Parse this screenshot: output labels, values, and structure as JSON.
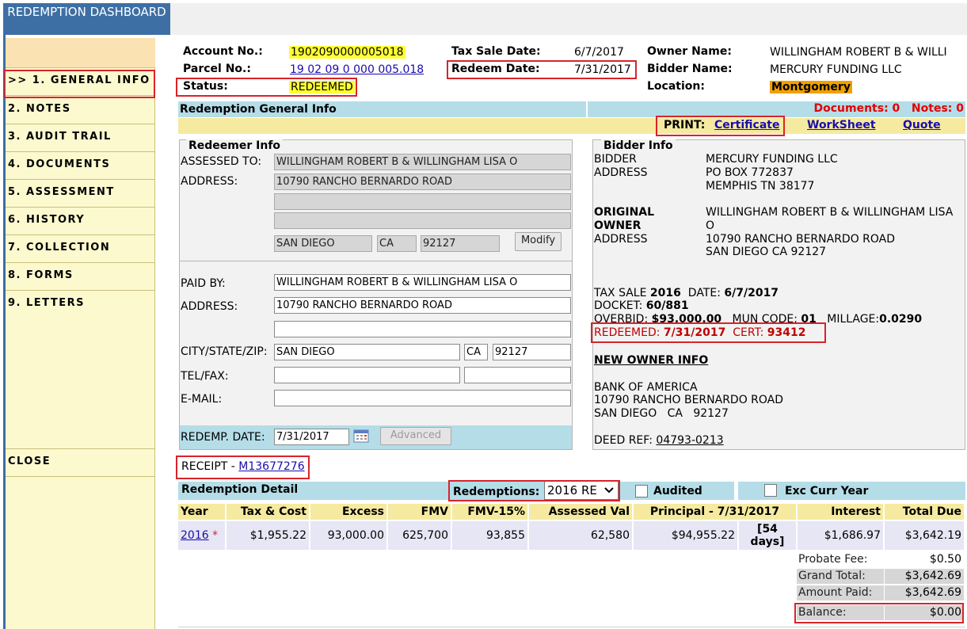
{
  "dashboard_title": "REDEMPTION DASHBOARD",
  "sidebar": {
    "items": [
      {
        "label": ">> 1. GENERAL INFO"
      },
      {
        "label": "2. NOTES"
      },
      {
        "label": "3. AUDIT TRAIL"
      },
      {
        "label": "4. DOCUMENTS"
      },
      {
        "label": "5. ASSESSMENT"
      },
      {
        "label": "6. HISTORY"
      },
      {
        "label": "7. COLLECTION"
      },
      {
        "label": "8. FORMS"
      },
      {
        "label": "9. LETTERS"
      }
    ],
    "close_label": "CLOSE"
  },
  "header": {
    "account_label": "Account No.:",
    "account_value": "1902090000005018",
    "parcel_label": "Parcel No.:",
    "parcel_value": "19 02 09 0 000 005.018",
    "status_label": "Status:",
    "status_value": "REDEEMED",
    "tax_sale_date_label": "Tax Sale Date:",
    "tax_sale_date_value": "6/7/2017",
    "redeem_date_label": "Redeem Date:",
    "redeem_date_value": "7/31/2017",
    "owner_label": "Owner Name:",
    "owner_value": "WILLINGHAM ROBERT B & WILLI",
    "bidder_label": "Bidder Name:",
    "bidder_value": "MERCURY FUNDING LLC",
    "location_label": "Location:",
    "location_value": "Montgomery"
  },
  "general_info": {
    "title": "Redemption General Info",
    "documents_label": "Documents: 0",
    "notes_label": "Notes: 0",
    "print_label": "PRINT:",
    "certificate_link": "Certificate",
    "worksheet_link": "WorkSheet",
    "quote_link": "Quote"
  },
  "redeemer": {
    "legend": "Redeemer Info",
    "assessed_to_label": "ASSESSED TO:",
    "assessed_to": "WILLINGHAM ROBERT B & WILLINGHAM LISA O",
    "address_label": "ADDRESS:",
    "address1": "10790  RANCHO BERNARDO ROAD",
    "address2": "",
    "address3": "",
    "city": "SAN DIEGO",
    "state": "CA",
    "zip": "92127",
    "modify_button": "Modify",
    "paid_by_label": "PAID BY:",
    "paid_by": "WILLINGHAM ROBERT B & WILLINGHAM LISA O",
    "paid_address_label": "ADDRESS:",
    "paid_address1": "10790  RANCHO BERNARDO ROAD",
    "paid_address2": "",
    "city_state_zip_label": "CITY/STATE/ZIP:",
    "paid_city": "SAN DIEGO",
    "paid_state": "CA",
    "paid_zip": "92127",
    "tel_fax_label": "TEL/FAX:",
    "tel": "",
    "fax": "",
    "email_label": "E-MAIL:",
    "email": "",
    "redemp_date_label": "REDEMP. DATE:",
    "redemp_date": "7/31/2017",
    "advanced_button": "Advanced"
  },
  "bidder": {
    "legend": "Bidder Info",
    "bidder_label": "BIDDER",
    "address_label": "ADDRESS",
    "bidder_name": "MERCURY FUNDING LLC",
    "bidder_addr1": "PO BOX 772837",
    "bidder_addr2": "MEMPHIS TN 38177",
    "orig_owner_label1": "ORIGINAL",
    "orig_owner_label2": "OWNER",
    "orig_owner_name1": "WILLINGHAM ROBERT B & WILLINGHAM LISA",
    "orig_owner_name2": "O",
    "orig_address_label": "ADDRESS",
    "orig_addr1": "10790 RANCHO BERNARDO ROAD",
    "orig_addr2": "SAN DIEGO CA 92127",
    "tax_sale_label": "TAX SALE",
    "tax_sale_year": "2016",
    "date_label": "DATE:",
    "date_value": "6/7/2017",
    "docket_label": "DOCKET:",
    "docket_value": "60/881",
    "overbid_label": "OVERBID:",
    "overbid_value": "$93,000.00",
    "mun_code_label": "MUN CODE:",
    "mun_code_value": "01",
    "millage_label": "MILLAGE:",
    "millage_value": "0.0290",
    "redeemed_label": "REDEEMED:",
    "redeemed_value": "7/31/2017",
    "cert_label": "CERT:",
    "cert_value": "93412",
    "new_owner_title": "NEW OWNER INFO",
    "new_owner_name": "BANK OF AMERICA",
    "new_owner_addr1": "10790 RANCHO BERNARDO ROAD",
    "new_owner_addr2": "SAN DIEGO   CA   92127",
    "deed_ref_label": "DEED REF:",
    "deed_ref_value": "04793-0213"
  },
  "receipt": {
    "label": "RECEIPT -",
    "number": "M13677276"
  },
  "detail": {
    "title": "Redemption Detail",
    "redemptions_label": "Redemptions:",
    "redemptions_value": "2016 RE",
    "audited_label": "Audited",
    "exc_curr_year_label": "Exc Curr Year",
    "columns": [
      "Year",
      "Tax & Cost",
      "Excess",
      "FMV",
      "FMV-15%",
      "Assessed Val",
      "Principal - 7/31/2017",
      "Interest",
      "Total Due"
    ],
    "row": {
      "year": "2016",
      "star": "*",
      "tax_cost": "$1,955.22",
      "excess": "93,000.00",
      "fmv": "625,700",
      "fmv15": "93,855",
      "assessed": "62,580",
      "principal": "$94,955.22",
      "days1": "[54",
      "days2": "days]",
      "interest": "$1,686.97",
      "total_due": "$3,642.19"
    },
    "summary": {
      "probate_label": "Probate Fee:",
      "probate_value": "$0.50",
      "grand_total_label": "Grand Total:",
      "grand_total_value": "$3,642.69",
      "amount_paid_label": "Amount Paid:",
      "amount_paid_value": "$3,642.69",
      "balance_label": "Balance:",
      "balance_value": "$0.00"
    }
  }
}
